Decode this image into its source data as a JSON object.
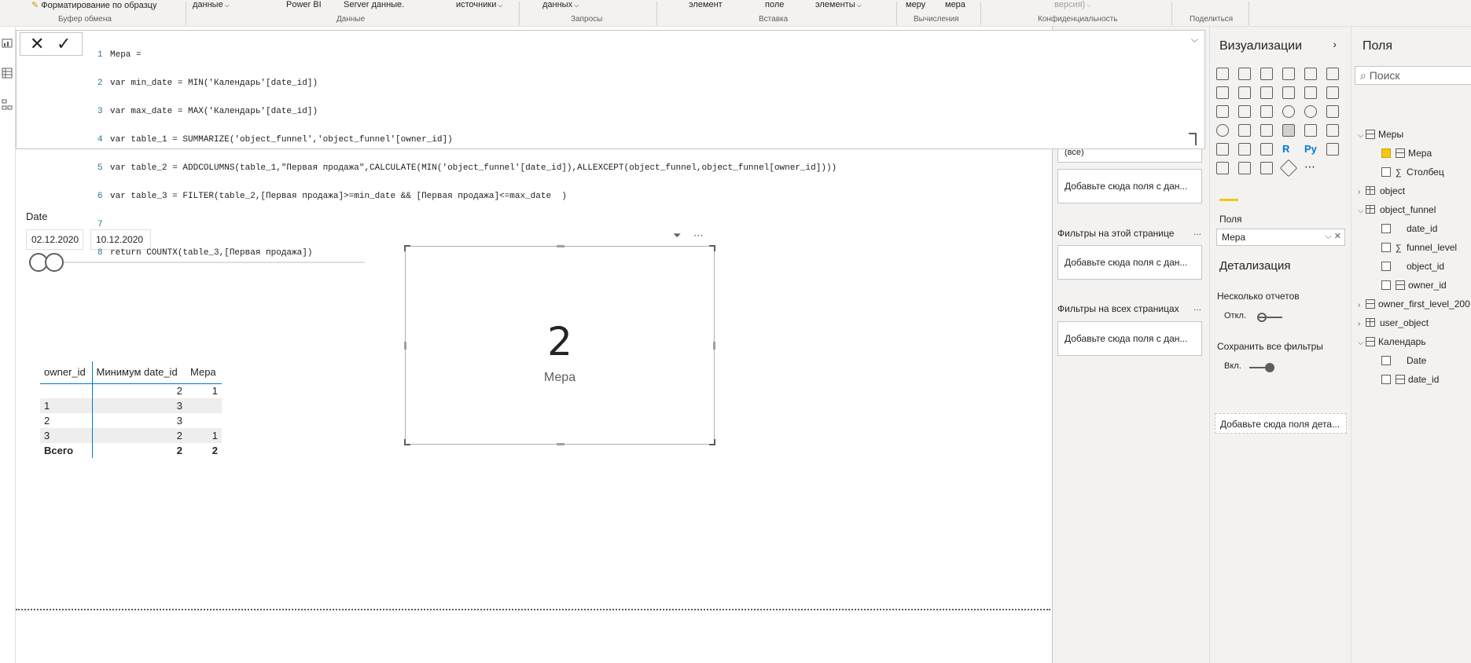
{
  "ribbon": {
    "items": [
      {
        "label": "Форматирование по образцу",
        "has_caret": false
      },
      {
        "label": "данные",
        "has_caret": true
      },
      {
        "label": "Power BI",
        "has_caret": false
      },
      {
        "label": "Server данные.",
        "has_caret": false
      },
      {
        "label": "источники",
        "has_caret": true
      },
      {
        "label": "данных",
        "has_caret": true
      },
      {
        "label": "элемент",
        "has_caret": false
      },
      {
        "label": "поле",
        "has_caret": false
      },
      {
        "label": "элементы",
        "has_caret": true
      },
      {
        "label": "меру",
        "has_caret": false
      },
      {
        "label": "мера",
        "has_caret": false
      },
      {
        "label": "версия)",
        "has_caret": true
      }
    ],
    "groups": [
      "Буфер обмена",
      "Данные",
      "Запросы",
      "Вставка",
      "Вычисления",
      "Конфиденциальность",
      "Поделиться"
    ]
  },
  "formula": {
    "lines": [
      {
        "n": "1",
        "text": "Мера ="
      },
      {
        "n": "2",
        "text": "var min_date = MIN('Календарь'[date_id])"
      },
      {
        "n": "3",
        "text": "var max_date = MAX('Календарь'[date_id])"
      },
      {
        "n": "4",
        "text": "var table_1 = SUMMARIZE('object_funnel','object_funnel'[owner_id])"
      },
      {
        "n": "5",
        "text": "var table_2 = ADDCOLUMNS(table_1,\"Первая продажа\",CALCULATE(MIN('object_funnel'[date_id]),ALLEXCEPT(object_funnel,object_funnel[owner_id])))"
      },
      {
        "n": "6",
        "text": "var table_3 = FILTER(table_2,[Первая продажа]>=min_date && [Первая продажа]<=max_date  )"
      },
      {
        "n": "7",
        "text": ""
      },
      {
        "n": "8",
        "text": "return COUNTX(table_3,[Первая продажа])"
      }
    ]
  },
  "slicer": {
    "title": "Date",
    "start": "02.12.2020",
    "end": "10.12.2020"
  },
  "table": {
    "headers": [
      "owner_id",
      "Минимум date_id",
      "Мера"
    ],
    "rows": [
      {
        "owner_id": "",
        "min": "2",
        "measure": "1"
      },
      {
        "owner_id": "1",
        "min": "3",
        "measure": ""
      },
      {
        "owner_id": "2",
        "min": "3",
        "measure": ""
      },
      {
        "owner_id": "3",
        "min": "2",
        "measure": "1"
      }
    ],
    "total": {
      "label": "Всего",
      "min": "2",
      "measure": "2"
    }
  },
  "card": {
    "value": "2",
    "label": "Мера"
  },
  "filters": {
    "visual_all": "(все)",
    "add_visual": "Добавьте сюда поля с дан...",
    "page_header": "Фильтры на этой странице",
    "add_page": "Добавьте сюда поля с дан...",
    "all_header": "Фильтры на всех страницах",
    "add_all": "Добавьте сюда поля с дан...",
    "more": "..."
  },
  "viz": {
    "title": "Визуализации",
    "fields_label": "Поля",
    "well_value": "Мера",
    "drill_title": "Детализация",
    "multi_reports": "Несколько отчетов",
    "multi_state": "Откл.",
    "keep_filters": "Сохранить все фильтры",
    "keep_state": "Вкл.",
    "drill_add": "Добавьте сюда поля дета..."
  },
  "fields": {
    "title": "Поля",
    "search_placeholder": "Поиск",
    "tree": [
      {
        "label": "Меры",
        "kind": "measure-table",
        "level": 0,
        "expanded": true
      },
      {
        "label": "Мера",
        "kind": "measure",
        "level": 1,
        "checked": true
      },
      {
        "label": "Столбец",
        "kind": "sigma",
        "level": 1,
        "checked": false
      },
      {
        "label": "object",
        "kind": "table",
        "level": 0,
        "expanded": false
      },
      {
        "label": "object_funnel",
        "kind": "table",
        "level": 0,
        "expanded": true
      },
      {
        "label": "date_id",
        "kind": "field",
        "level": 1,
        "checked": false
      },
      {
        "label": "funnel_level",
        "kind": "sigma",
        "level": 1,
        "checked": false
      },
      {
        "label": "object_id",
        "kind": "field",
        "level": 1,
        "checked": false
      },
      {
        "label": "owner_id",
        "kind": "calc",
        "level": 1,
        "checked": false
      },
      {
        "label": "owner_first_level_200",
        "kind": "calc-table",
        "level": 0,
        "expanded": false
      },
      {
        "label": "user_object",
        "kind": "table",
        "level": 0,
        "expanded": false
      },
      {
        "label": "Календарь",
        "kind": "calc-table",
        "level": 0,
        "expanded": true
      },
      {
        "label": "Date",
        "kind": "field",
        "level": 1,
        "checked": false
      },
      {
        "label": "date_id",
        "kind": "calc",
        "level": 1,
        "checked": false
      }
    ]
  },
  "colors": {
    "accent": "#f2c811",
    "table_border": "#0078d4",
    "code_keyword": "#0000ff",
    "code_string": "#a31515"
  }
}
